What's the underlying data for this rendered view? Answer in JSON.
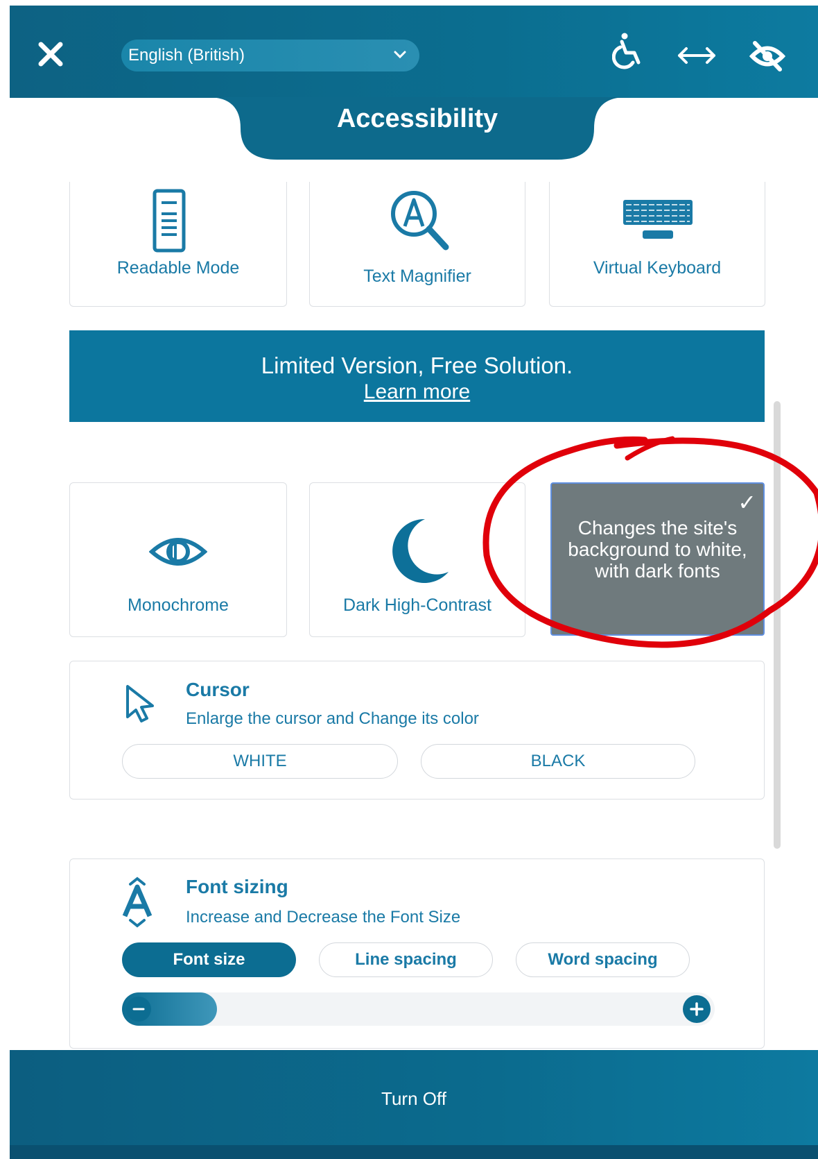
{
  "header": {
    "language": "English (British)",
    "icons": [
      "close-icon",
      "accessibility-person-icon",
      "horizontal-arrows-icon",
      "eye-slash-icon"
    ]
  },
  "tab": {
    "title": "Accessibility"
  },
  "top_cards": [
    {
      "label": "Readable Mode",
      "icon": "document-icon"
    },
    {
      "label": "Text Magnifier",
      "icon": "magnifier-icon"
    },
    {
      "label": "Virtual Keyboard",
      "icon": "keyboard-icon"
    }
  ],
  "banner": {
    "line1": "Limited Version, Free Solution.",
    "link": "Learn more"
  },
  "contrast_cards": [
    {
      "label": "Monochrome",
      "icon": "eye-icon"
    },
    {
      "label": "Dark High-Contrast",
      "icon": "moon-icon"
    }
  ],
  "tooltip": {
    "check": "✓",
    "text": "Changes the site's background to white, with dark fonts"
  },
  "cursor": {
    "title": "Cursor",
    "subtitle": "Enlarge the cursor and Change its color",
    "buttons": [
      "WHITE",
      "BLACK"
    ]
  },
  "font_sizing": {
    "title": "Font sizing",
    "subtitle": "Increase and Decrease the Font Size",
    "tabs": [
      "Font size",
      "Line spacing",
      "Word spacing"
    ],
    "active_tab": "Font size",
    "slider_level_fraction": 0.16
  },
  "footer": {
    "button": "Turn Off"
  },
  "colors": {
    "primary": "#0c6d92",
    "text": "#1a7aa6",
    "highlight_ring": "#e0000a"
  }
}
